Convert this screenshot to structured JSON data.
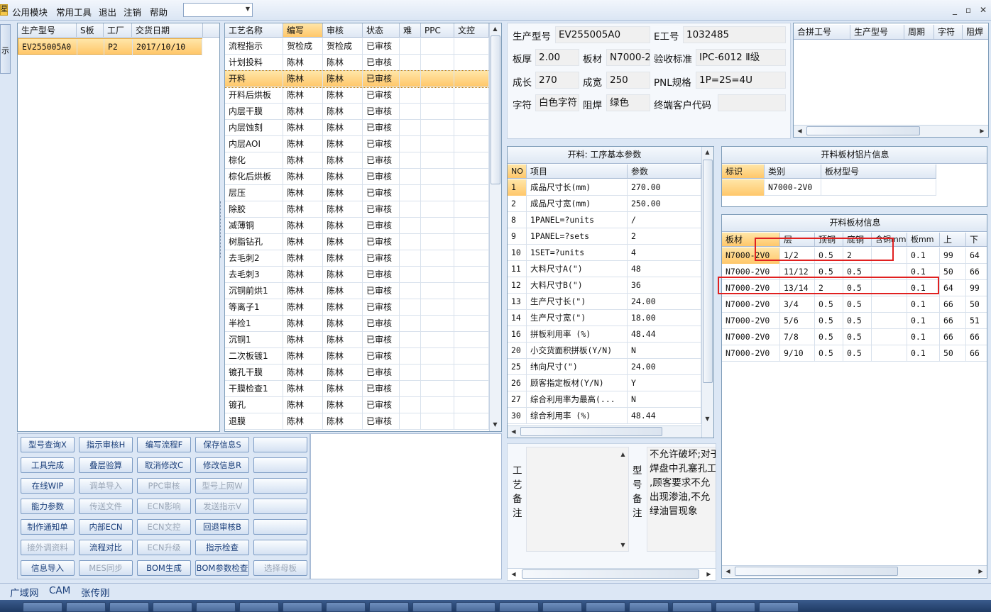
{
  "menu": {
    "logo": "星",
    "items": [
      "公用模块",
      "常用工具",
      "退出",
      "注销",
      "帮助"
    ],
    "combo_value": "",
    "win_controls": [
      "_",
      "▫",
      "✕"
    ]
  },
  "left_tab": "示",
  "order_list": {
    "headers": [
      "生产型号",
      "S板",
      "工厂",
      "交货日期"
    ],
    "rows": [
      [
        "EV255005A0",
        "",
        "P2",
        "2017/10/10"
      ]
    ]
  },
  "process_list": {
    "headers": [
      "工艺名称",
      "编写",
      "审核",
      "状态",
      "难",
      "PPC",
      "文控"
    ],
    "selected_index": 2,
    "rows": [
      [
        "流程指示",
        "贺检成",
        "贺检成",
        "已审核"
      ],
      [
        "计划投料",
        "陈林",
        "陈林",
        "已审核"
      ],
      [
        "开料",
        "陈林",
        "陈林",
        "已审核"
      ],
      [
        "开料后烘板",
        "陈林",
        "陈林",
        "已审核"
      ],
      [
        "内层干膜",
        "陈林",
        "陈林",
        "已审核"
      ],
      [
        "内层蚀刻",
        "陈林",
        "陈林",
        "已审核"
      ],
      [
        "内层AOI",
        "陈林",
        "陈林",
        "已审核"
      ],
      [
        "棕化",
        "陈林",
        "陈林",
        "已审核"
      ],
      [
        "棕化后烘板",
        "陈林",
        "陈林",
        "已审核"
      ],
      [
        "层压",
        "陈林",
        "陈林",
        "已审核"
      ],
      [
        "除胶",
        "陈林",
        "陈林",
        "已审核"
      ],
      [
        "减薄铜",
        "陈林",
        "陈林",
        "已审核"
      ],
      [
        "树脂钻孔",
        "陈林",
        "陈林",
        "已审核"
      ],
      [
        "去毛刺2",
        "陈林",
        "陈林",
        "已审核"
      ],
      [
        "去毛刺3",
        "陈林",
        "陈林",
        "已审核"
      ],
      [
        "沉铜前烘1",
        "陈林",
        "陈林",
        "已审核"
      ],
      [
        "等离子1",
        "陈林",
        "陈林",
        "已审核"
      ],
      [
        "半检1",
        "陈林",
        "陈林",
        "已审核"
      ],
      [
        "沉铜1",
        "陈林",
        "陈林",
        "已审核"
      ],
      [
        "二次板镀1",
        "陈林",
        "陈林",
        "已审核"
      ],
      [
        "镀孔干膜",
        "陈林",
        "陈林",
        "已审核"
      ],
      [
        "干膜检查1",
        "陈林",
        "陈林",
        "已审核"
      ],
      [
        "镀孔",
        "陈林",
        "陈林",
        "已审核"
      ],
      [
        "退膜",
        "陈林",
        "陈林",
        "已审核"
      ]
    ]
  },
  "info": {
    "model_label": "生产型号",
    "model": "EV255005A0",
    "e_label": "E工号",
    "e_no": "1032485",
    "thick_label": "板厚",
    "thick": "2.00",
    "mat_label": "板材",
    "mat": "N7000-2",
    "std_label": "验收标准",
    "std": "IPC-6012 Ⅱ级",
    "len_label": "成长",
    "len": "270",
    "wid_label": "成宽",
    "wid": "250",
    "pnl_label": "PNL规格",
    "pnl": "1P=2S=4U",
    "char_label": "字符",
    "char": "白色字符",
    "mask_label": "阻焊",
    "mask": "绿色",
    "cust_label": "终端客户代码",
    "cust": ""
  },
  "combine": {
    "headers": [
      "合拼工号",
      "生产型号",
      "周期",
      "字符",
      "阻焊"
    ]
  },
  "params": {
    "title": "开料: 工序基本参数",
    "headers": [
      "NO",
      "项目",
      "参数"
    ],
    "rows": [
      [
        "1",
        "成品尺寸长(mm)",
        "270.00"
      ],
      [
        "2",
        "成品尺寸宽(mm)",
        "250.00"
      ],
      [
        "8",
        "1PANEL=?units",
        "/"
      ],
      [
        "9",
        "1PANEL=?sets",
        "2"
      ],
      [
        "10",
        "1SET=?units",
        "4"
      ],
      [
        "11",
        "大料尺寸A(\")",
        "48"
      ],
      [
        "12",
        "大料尺寸B(\")",
        "36"
      ],
      [
        "13",
        "生产尺寸长(\")",
        "24.00"
      ],
      [
        "14",
        "生产尺寸宽(\")",
        "18.00"
      ],
      [
        "16",
        "拼板利用率 (%)",
        "48.44"
      ],
      [
        "20",
        "小交货面积拼板(Y/N)",
        "N"
      ],
      [
        "25",
        "纬向尺寸(\")",
        "24.00"
      ],
      [
        "26",
        "顾客指定板材(Y/N)",
        "Y"
      ],
      [
        "27",
        "综合利用率为最高(...",
        "N"
      ],
      [
        "30",
        "综合利用率 (%)",
        "48.44"
      ]
    ]
  },
  "sheet": {
    "title": "开料板材铝片信息",
    "headers": [
      "标识",
      "类别",
      "板材型号"
    ],
    "rows": [
      [
        "",
        "N7000-2V0",
        ""
      ]
    ]
  },
  "material": {
    "title": "开料板材信息",
    "headers": [
      "板材",
      "层",
      "顶铜",
      "底铜",
      "含铜mm",
      "板mm",
      "上",
      "下"
    ],
    "rows": [
      [
        "N7000-2V0",
        "1/2",
        "0.5",
        "2",
        "",
        "0.1",
        "99",
        "64"
      ],
      [
        "N7000-2V0",
        "11/12",
        "0.5",
        "0.5",
        "",
        "0.1",
        "50",
        "66"
      ],
      [
        "N7000-2V0",
        "13/14",
        "2",
        "0.5",
        "",
        "0.1",
        "64",
        "99"
      ],
      [
        "N7000-2V0",
        "3/4",
        "0.5",
        "0.5",
        "",
        "0.1",
        "66",
        "50"
      ],
      [
        "N7000-2V0",
        "5/6",
        "0.5",
        "0.5",
        "",
        "0.1",
        "66",
        "51"
      ],
      [
        "N7000-2V0",
        "7/8",
        "0.5",
        "0.5",
        "",
        "0.1",
        "66",
        "66"
      ],
      [
        "N7000-2V0",
        "9/10",
        "0.5",
        "0.5",
        "",
        "0.1",
        "50",
        "66"
      ]
    ]
  },
  "remarks": {
    "proc_label": [
      "工",
      "艺",
      "备",
      "注"
    ],
    "model_label": [
      "型",
      "号",
      "备",
      "注"
    ],
    "model_text": [
      "不允许破坏;对于",
      "焊盘中孔塞孔工",
      ",顾客要求不允",
      "出现渗油,不允",
      "绿油冒现象"
    ]
  },
  "buttons": [
    [
      {
        "label": "型号查询X",
        "enabled": true
      },
      {
        "label": "指示审核H",
        "enabled": true
      },
      {
        "label": "编写流程F",
        "enabled": true
      },
      {
        "label": "保存信息S",
        "enabled": true
      },
      {
        "label": "",
        "enabled": true
      }
    ],
    [
      {
        "label": "工具完成",
        "enabled": true
      },
      {
        "label": "叠层验算",
        "enabled": true
      },
      {
        "label": "取消修改C",
        "enabled": true
      },
      {
        "label": "修改信息R",
        "enabled": true
      },
      {
        "label": "",
        "enabled": true
      }
    ],
    [
      {
        "label": "在线WIP",
        "enabled": true
      },
      {
        "label": "调单导入",
        "enabled": false
      },
      {
        "label": "PPC审核",
        "enabled": false
      },
      {
        "label": "型号上网W",
        "enabled": false
      },
      {
        "label": "",
        "enabled": true
      }
    ],
    [
      {
        "label": "能力参数",
        "enabled": true
      },
      {
        "label": "传送文件",
        "enabled": false
      },
      {
        "label": "ECN影响",
        "enabled": false
      },
      {
        "label": "发送指示V",
        "enabled": false
      },
      {
        "label": "",
        "enabled": true
      }
    ],
    [
      {
        "label": "制作通知单",
        "enabled": true
      },
      {
        "label": "内部ECN",
        "enabled": true
      },
      {
        "label": "ECN文控",
        "enabled": false
      },
      {
        "label": "回退审核B",
        "enabled": true
      },
      {
        "label": "",
        "enabled": true
      }
    ],
    [
      {
        "label": "接外调资料",
        "enabled": false
      },
      {
        "label": "流程对比",
        "enabled": true
      },
      {
        "label": "ECN升级",
        "enabled": false
      },
      {
        "label": "指示检查",
        "enabled": true
      },
      {
        "label": "",
        "enabled": true
      }
    ],
    [
      {
        "label": "信息导入",
        "enabled": true
      },
      {
        "label": "MES同步",
        "enabled": false
      },
      {
        "label": "BOM生成",
        "enabled": true
      },
      {
        "label": "BOM参数检查",
        "enabled": true
      },
      {
        "label": "选择母板",
        "enabled": false
      }
    ]
  ],
  "status": [
    "广域网",
    "CAM",
    "张传刚"
  ],
  "colors": {
    "selection": "#ffc76a",
    "highlight_box": "#e02020",
    "accent": "#1b3f7a"
  }
}
